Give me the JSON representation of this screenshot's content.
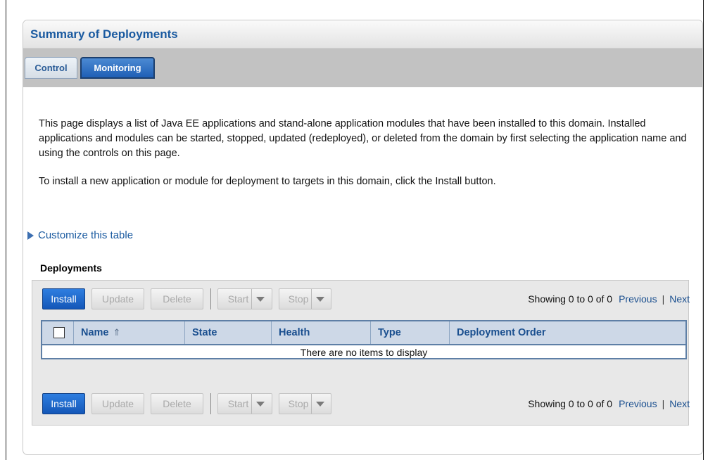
{
  "panel": {
    "title": "Summary of Deployments"
  },
  "tabs": [
    {
      "label": "Control",
      "active": false
    },
    {
      "label": "Monitoring",
      "active": true
    }
  ],
  "description": {
    "para1": "This page displays a list of Java EE applications and stand-alone application modules that have been installed to this domain. Installed applications and modules can be started, stopped, updated (redeployed), or deleted from the domain by first selecting the application name and using the controls on this page.",
    "para2": "To install a new application or module for deployment to targets in this domain, click the Install button."
  },
  "customize_link": "Customize this table",
  "table": {
    "section_title": "Deployments",
    "toolbar": {
      "install": "Install",
      "update": "Update",
      "delete": "Delete",
      "start": "Start",
      "stop": "Stop"
    },
    "pager": {
      "showing": "Showing 0 to 0 of 0",
      "previous": "Previous",
      "separator": "|",
      "next": "Next"
    },
    "columns": [
      "Name",
      "State",
      "Health",
      "Type",
      "Deployment Order"
    ],
    "empty_message": "There are no items to display"
  },
  "colors": {
    "accent": "#1a5aa0",
    "primary_button": "#1f6ad0",
    "grid_header": "#cdd8e7"
  }
}
